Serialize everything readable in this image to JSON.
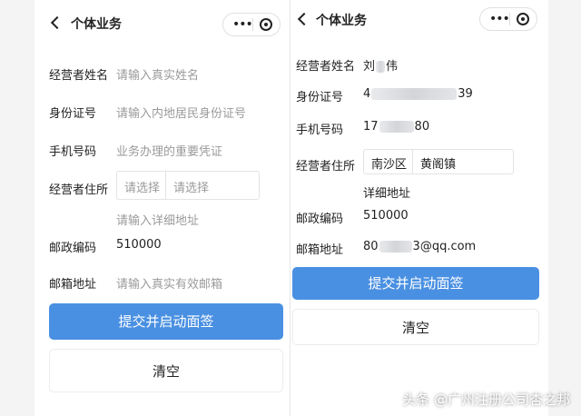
{
  "left": {
    "title": "个体业务",
    "fields": [
      {
        "label": "经营者姓名",
        "placeholder": "请输入真实姓名"
      },
      {
        "label": "身份证号",
        "placeholder": "请输入内地居民身份证号"
      },
      {
        "label": "手机号码",
        "placeholder": "业务办理的重要凭证"
      },
      {
        "label": "经营者住所",
        "select1": "请选择",
        "select2": "请选择",
        "detail": "请输入详细地址"
      },
      {
        "label": "邮政编码",
        "value": "510000"
      },
      {
        "label": "邮箱地址",
        "placeholder": "请输入真实有效邮箱"
      }
    ],
    "submit_label": "提交并启动面签",
    "clear_label": "清空"
  },
  "right": {
    "title": "个体业务",
    "fields": [
      {
        "label": "经营者姓名",
        "value_start": "刘",
        "value_end": "伟"
      },
      {
        "label": "身份证号",
        "value_start": "4",
        "value_end": "39"
      },
      {
        "label": "手机号码",
        "value_start": "17",
        "value_end": "80"
      },
      {
        "label": "经营者住所",
        "select1": "南沙区",
        "select2": "黄阁镇",
        "detail": "详细地址"
      },
      {
        "label": "邮政编码",
        "value": "510000"
      },
      {
        "label": "邮箱地址",
        "value_start": "80",
        "value_end": "3@qq.com"
      }
    ],
    "submit_label": "提交并启动面签",
    "clear_label": "清空"
  },
  "watermark": "头条 @广州注册公司杏之邦",
  "colors": {
    "primary": "#4a90e2"
  }
}
